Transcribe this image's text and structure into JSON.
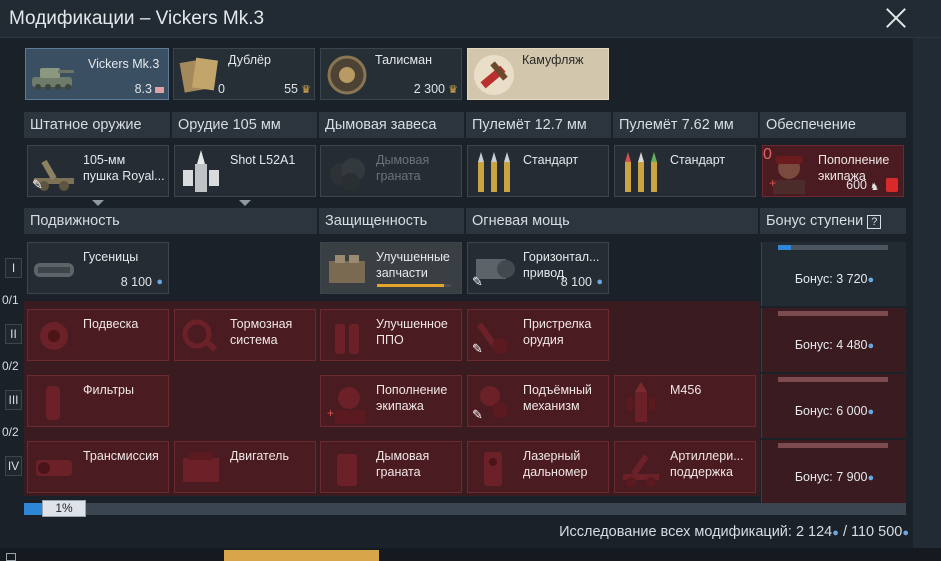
{
  "window": {
    "title": "Модификации – Vickers Mk.3"
  },
  "slots": {
    "vehicle": {
      "name": "Vickers Mk.3",
      "br": "8.3"
    },
    "backup": {
      "name": "Дублёр",
      "count": "0",
      "price": "55"
    },
    "talisman": {
      "name": "Талисман",
      "price": "2 300"
    },
    "camo": {
      "name": "Камуфляж"
    }
  },
  "weapon_headers": [
    "Штатное оружие",
    "Орудие 105 мм",
    "Дымовая завеса",
    "Пулемёт 12.7 мм",
    "Пулемёт 7.62 мм",
    "Обеспечение"
  ],
  "weapons": {
    "main": {
      "name1": "105-мм",
      "name2": "пушка Royal..."
    },
    "shell": {
      "name": "Shot L52A1"
    },
    "smoke": {
      "name1": "Дымовая",
      "name2": "граната"
    },
    "mg127": {
      "name": "Стандарт"
    },
    "mg762": {
      "name": "Стандарт"
    },
    "crew": {
      "name1": "Пополнение",
      "name2": "экипажа",
      "count": "0",
      "price": "600"
    }
  },
  "section_headers": {
    "mobility": "Подвижность",
    "protection": "Защищенность",
    "firepower": "Огневая мощь",
    "bonus": "Бонус ступени",
    "bonus_help": "?"
  },
  "tiers": [
    {
      "label": "I",
      "count": "0/1"
    },
    {
      "label": "II",
      "count": "0/2"
    },
    {
      "label": "III",
      "count": "0/2"
    },
    {
      "label": "IV",
      "count": ""
    }
  ],
  "mods": {
    "tracks": {
      "name": "Гусеницы",
      "price": "8 100"
    },
    "parts": {
      "name1": "Улучшенные",
      "name2": "запчасти",
      "progress": 0.9
    },
    "horizontal": {
      "name1": "Горизонтал...",
      "name2": "привод",
      "price": "8 100"
    },
    "suspension": {
      "name": "Подвеска"
    },
    "brakes": {
      "name1": "Тормозная",
      "name2": "система"
    },
    "aa": {
      "name1": "Улучшенное",
      "name2": "ППО"
    },
    "zeroing": {
      "name1": "Пристрелка",
      "name2": "орудия"
    },
    "filters": {
      "name": "Фильтры"
    },
    "crew2": {
      "name1": "Пополнение",
      "name2": "экипажа"
    },
    "elevation": {
      "name1": "Подъёмный",
      "name2": "механизм"
    },
    "m456": {
      "name": "M456"
    },
    "transmission": {
      "name": "Трансмиссия"
    },
    "engine": {
      "name": "Двигатель"
    },
    "smoke2": {
      "name1": "Дымовая",
      "name2": "граната"
    },
    "laser": {
      "name1": "Лазерный",
      "name2": "дальномер"
    },
    "artillery": {
      "name1": "Артиллери...",
      "name2": "поддержка"
    }
  },
  "bonuses": [
    {
      "text": "Бонус: 3 720",
      "progress": 0.12
    },
    {
      "text": "Бонус: 4 480",
      "progress": 0
    },
    {
      "text": "Бонус: 6 000",
      "progress": 0
    },
    {
      "text": "Бонус: 7 900",
      "progress": 0
    }
  ],
  "research": {
    "percent_label": "1%",
    "progress": 0.01,
    "total": "Исследование всех модификаций: 2 124",
    "total_max": "/ 110 500"
  },
  "colors": {
    "accent": "#2d86d6",
    "locked_red": "#4a1c21",
    "gold": "#e3b04b"
  }
}
